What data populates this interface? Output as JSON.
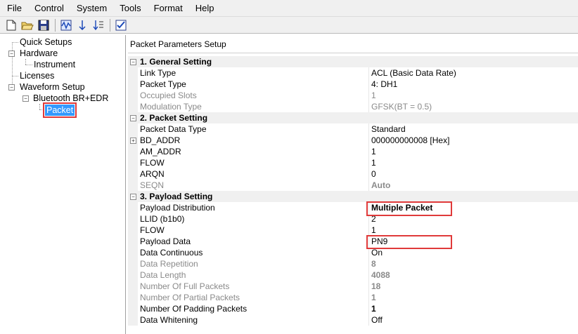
{
  "menu": [
    "File",
    "Control",
    "System",
    "Tools",
    "Format",
    "Help"
  ],
  "toolbar": [
    "new-icon",
    "open-icon",
    "save-icon",
    "waveform-icon",
    "sort-icon",
    "sort-list-icon",
    "checkbox-icon"
  ],
  "tree": {
    "quick_setups": "Quick Setups",
    "hardware": "Hardware",
    "instrument": "Instrument",
    "licenses": "Licenses",
    "waveform_setup": "Waveform Setup",
    "bluetooth": "Bluetooth BR+EDR",
    "packet": "Packet"
  },
  "panel": {
    "title": "Packet Parameters Setup"
  },
  "sections": {
    "general": {
      "title": "1. General Setting",
      "rows": [
        {
          "label": "Link Type",
          "value": "ACL (Basic Data Rate)",
          "style": ""
        },
        {
          "label": "Packet Type",
          "value": "4: DH1",
          "style": ""
        },
        {
          "label": "Occupied Slots",
          "value": "1",
          "style": "dis"
        },
        {
          "label": "Modulation Type",
          "value": "GFSK(BT = 0.5)",
          "style": "dis"
        }
      ]
    },
    "packet": {
      "title": "2. Packet Setting",
      "rows": [
        {
          "label": "Packet Data Type",
          "value": "Standard",
          "style": ""
        },
        {
          "label": "BD_ADDR",
          "value": "000000000008 [Hex]",
          "style": ""
        },
        {
          "label": "AM_ADDR",
          "value": "1",
          "style": ""
        },
        {
          "label": "FLOW",
          "value": "1",
          "style": ""
        },
        {
          "label": "ARQN",
          "value": "0",
          "style": ""
        },
        {
          "label": "SEQN",
          "value": "Auto",
          "style": "dis-bold"
        }
      ]
    },
    "payload": {
      "title": "3. Payload Setting",
      "rows": [
        {
          "label": "Payload Distribution",
          "value": "Multiple Packet",
          "style": "bold"
        },
        {
          "label": "LLID (b1b0)",
          "value": "2",
          "style": ""
        },
        {
          "label": "FLOW",
          "value": "1",
          "style": ""
        },
        {
          "label": "Payload Data",
          "value": "PN9",
          "style": ""
        },
        {
          "label": "Data Continuous",
          "value": "On",
          "style": ""
        },
        {
          "label": "Data Repetition",
          "value": "8",
          "style": "dis-bold"
        },
        {
          "label": "Data Length",
          "value": "4088",
          "style": "dis-bold"
        },
        {
          "label": "Number Of Full Packets",
          "value": "18",
          "style": "dis-bold"
        },
        {
          "label": "Number Of Partial Packets",
          "value": "1",
          "style": "dis-bold"
        },
        {
          "label": "Number Of Padding Packets",
          "value": "1",
          "style": "bold"
        },
        {
          "label": "Data Whitening",
          "value": "Off",
          "style": ""
        }
      ]
    }
  }
}
